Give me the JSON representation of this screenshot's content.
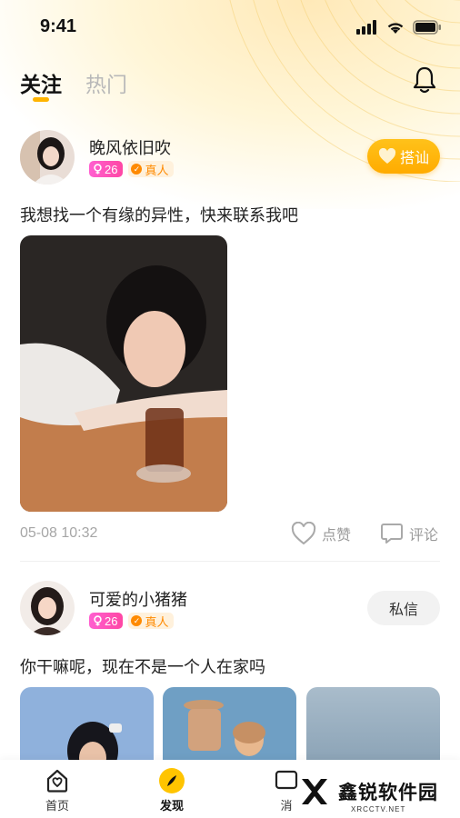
{
  "status_bar": {
    "time": "9:41"
  },
  "header": {
    "tabs": [
      {
        "label": "关注",
        "active": true
      },
      {
        "label": "热门",
        "active": false
      }
    ]
  },
  "posts": [
    {
      "username": "晚风依旧吹",
      "age": "26",
      "verified_label": "真人",
      "action_button": "搭讪",
      "text": "我想找一个有缘的异性，快来联系我吧",
      "timestamp": "05-08 10:32",
      "like_label": "点赞",
      "comment_label": "评论"
    },
    {
      "username": "可爱的小猪猪",
      "age": "26",
      "verified_label": "真人",
      "action_button": "私信",
      "text": "你干嘛呢，现在不是一个人在家吗"
    }
  ],
  "tabbar": {
    "items": [
      {
        "label": "首页",
        "icon": "home-icon"
      },
      {
        "label": "发现",
        "icon": "compass-icon",
        "active": true
      },
      {
        "label": "消",
        "icon": "message-icon"
      }
    ]
  },
  "watermark": {
    "brand": "鑫锐软件园",
    "domain": "XRCCTV.NET"
  },
  "colors": {
    "accent": "#ffb400",
    "age_badge": "#ff4fb0",
    "real_badge": "#ff8a00"
  }
}
